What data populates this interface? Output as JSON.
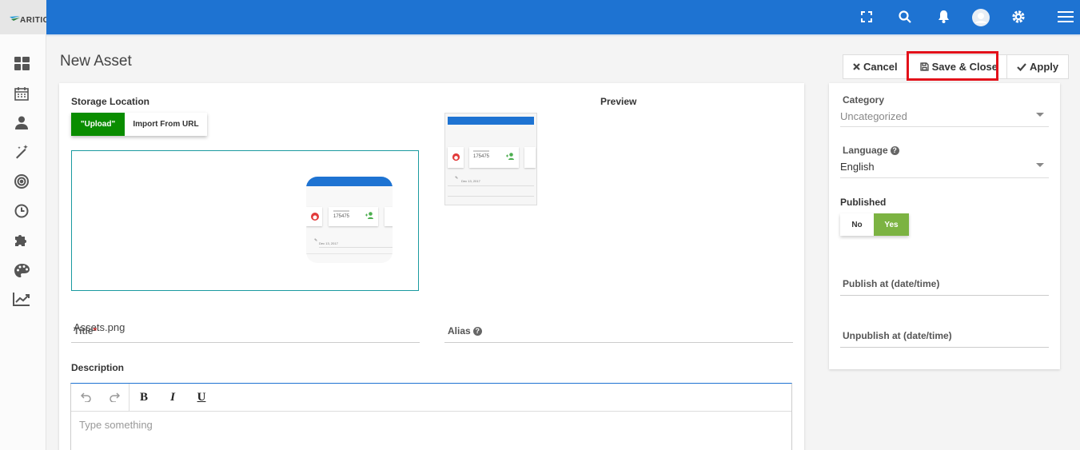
{
  "brand": {
    "name": "ARITIC"
  },
  "topbar": {
    "icons": [
      "fullscreen-icon",
      "search-icon",
      "bell-icon",
      "user-avatar-icon",
      "gear-icon",
      "hamburger-menu-icon"
    ]
  },
  "sidebar": {
    "icons": [
      "dashboard-icon",
      "calendar-icon",
      "contacts-icon",
      "magic-wand-icon",
      "target-icon",
      "clock-icon",
      "puzzle-icon",
      "palette-icon",
      "chart-line-icon"
    ]
  },
  "page": {
    "title": "New Asset"
  },
  "actions": {
    "cancel": "Cancel",
    "save_close": "Save & Close",
    "apply": "Apply"
  },
  "form": {
    "storage_location_label": "Storage Location",
    "upload_label": "\"Upload\"",
    "import_url_label": "Import From URL",
    "preview_label": "Preview",
    "title_value": "Assets.png",
    "title_label": "Title",
    "alias_label": "Alias",
    "description_label": "Description",
    "editor_placeholder": "Type something",
    "editor_tools": {
      "bold": "B",
      "italic": "I",
      "underline": "U"
    },
    "thumbnail_number": "175475",
    "thumbnail_date": "Dec 13, 2017"
  },
  "side": {
    "category_label": "Category",
    "category_value": "Uncategorized",
    "language_label": "Language",
    "language_value": "English",
    "published_label": "Published",
    "no_label": "No",
    "yes_label": "Yes",
    "publish_at_label": "Publish at (date/time)",
    "unpublish_at_label": "Unpublish at (date/time)"
  },
  "colors": {
    "primary": "#1e73d2",
    "upload_green": "#0a8d00",
    "yes_green": "#7cb342",
    "highlight_red": "#e3111a"
  }
}
